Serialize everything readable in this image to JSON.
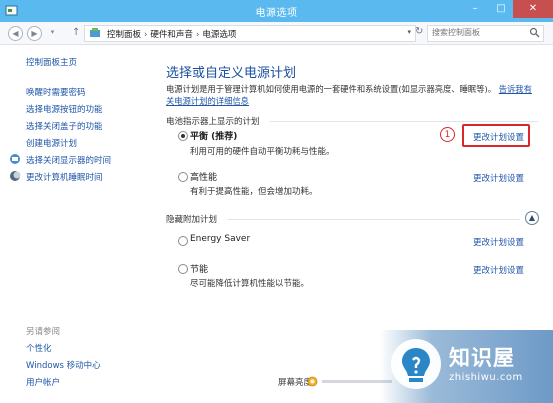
{
  "window": {
    "title": "电源选项",
    "min_label": "–",
    "max_label": "□",
    "close_label": "✕"
  },
  "address": {
    "crumbs": [
      "控制面板",
      "硬件和声音",
      "电源选项"
    ],
    "search_placeholder": "搜索控制面板"
  },
  "sidebar": {
    "home": "控制面板主页",
    "items": [
      {
        "label": "唤醒时需要密码",
        "icon": null
      },
      {
        "label": "选择电源按钮的功能",
        "icon": null
      },
      {
        "label": "选择关闭盖子的功能",
        "icon": null
      },
      {
        "label": "创建电源计划",
        "icon": null
      },
      {
        "label": "选择关闭显示器的时间",
        "icon": "display-icon"
      },
      {
        "label": "更改计算机睡眠时间",
        "icon": "moon-icon"
      }
    ],
    "see_also": "另请参阅",
    "see_also_items": [
      "个性化",
      "Windows 移动中心",
      "用户帐户"
    ]
  },
  "main": {
    "heading": "选择或自定义电源计划",
    "description": "电源计划是用于管理计算机如何使用电源的一套硬件和系统设置(如显示器亮度、睡眠等)。",
    "description_link": "告诉我有关电源计划的详细信息",
    "battery_group": "电池指示器上显示的计划",
    "hidden_group": "隐藏附加计划",
    "change_label": "更改计划设置",
    "plans": [
      {
        "name": "平衡 (推荐)",
        "desc": "利用可用的硬件自动平衡功耗与性能。",
        "selected": true
      },
      {
        "name": "高性能",
        "desc": "有利于提高性能，但会增加功耗。",
        "selected": false
      },
      {
        "name": "Energy Saver",
        "desc": "",
        "selected": false
      },
      {
        "name": "节能",
        "desc": "尽可能降低计算机性能以节能。",
        "selected": false
      }
    ],
    "annotation_marker": "1",
    "brightness_label": "屏幕亮度:"
  },
  "watermark": {
    "title": "知识屋",
    "subtitle": "zhishiwu.com"
  },
  "colors": {
    "titlebar": "#5ab9ee",
    "link": "#1f56a8",
    "heading": "#1a4fa0",
    "annotation": "#d8282b",
    "close": "#c74f50"
  }
}
